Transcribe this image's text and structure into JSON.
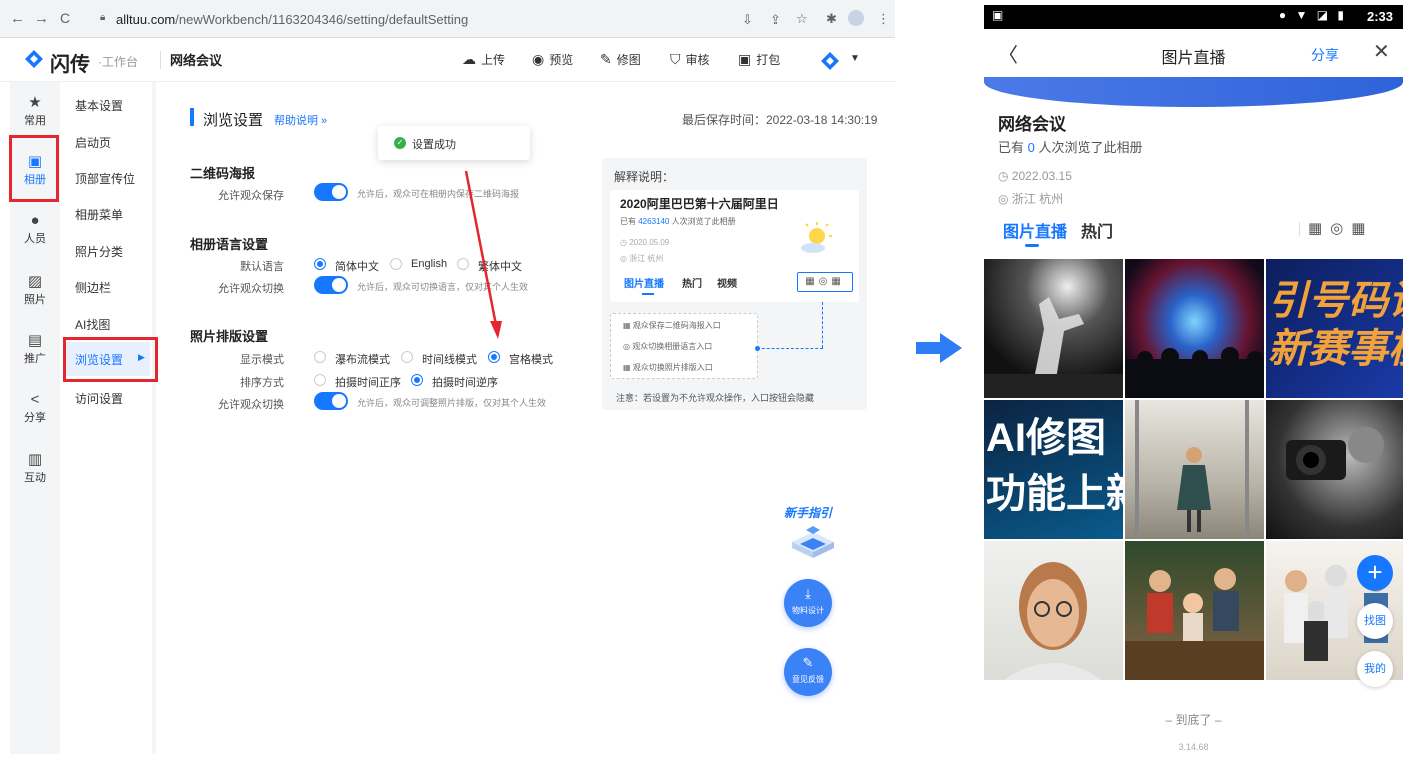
{
  "browser": {
    "url_host": "alltuu.com",
    "url_path": "/newWorkbench/1163204346/setting/defaultSetting",
    "back_icon": "←",
    "forward_icon": "→",
    "reload_icon": "C"
  },
  "header": {
    "brand": "闪传",
    "brand_sub": "·工作台",
    "project": "网络会议",
    "tools": [
      {
        "label": "上传",
        "icon": "cloud-upload-icon"
      },
      {
        "label": "预览",
        "icon": "eye-icon"
      },
      {
        "label": "修图",
        "icon": "brush-icon"
      },
      {
        "label": "审核",
        "icon": "shield-icon"
      },
      {
        "label": "打包",
        "icon": "package-icon"
      }
    ]
  },
  "leftbar": {
    "items": [
      {
        "label": "常用",
        "icon": "★"
      },
      {
        "label": "相册",
        "icon": "▣"
      },
      {
        "label": "人员",
        "icon": "●"
      },
      {
        "label": "照片",
        "icon": "▨"
      },
      {
        "label": "推广",
        "icon": "▤"
      },
      {
        "label": "分享",
        "icon": "<"
      },
      {
        "label": "互动",
        "icon": "▥"
      }
    ]
  },
  "subnav": {
    "items": [
      "基本设置",
      "启动页",
      "顶部宣传位",
      "相册菜单",
      "照片分类",
      "侧边栏",
      "AI找图",
      "浏览设置",
      "访问设置"
    ],
    "active_arrow": "▶"
  },
  "main": {
    "title": "浏览设置",
    "help": "帮助说明 »",
    "savetime": "最后保存时间：2022-03-18 14:30:19",
    "toast": "设置成功",
    "sections": {
      "qr": {
        "title": "二维码海报",
        "label": "允许观众保存",
        "hint": "允许后，观众可在相册内保存二维码海报"
      },
      "lang": {
        "title": "相册语言设置",
        "default_label": "默认语言",
        "options": [
          "简体中文",
          "English",
          "繁体中文"
        ],
        "switch_label": "允许观众切换",
        "hint": "允许后，观众可切换语言，仅对其个人生效"
      },
      "layout": {
        "title": "照片排版设置",
        "mode_label": "显示模式",
        "modes": [
          "瀑布流模式",
          "时间线模式",
          "宫格模式"
        ],
        "sort_label": "排序方式",
        "sorts": [
          "拍摄时间正序",
          "拍摄时间逆序"
        ],
        "switch_label": "允许观众切换",
        "hint": "允许后，观众可调整照片排版，仅对其个人生效"
      }
    }
  },
  "explain": {
    "title": "解释说明：",
    "album": "2020阿里巴巴第十六届阿里日",
    "views_prefix": "已有 ",
    "views_count": "4263140",
    "views_suffix": " 人次浏览了此相册",
    "date": "◷ 2020.05.09",
    "location": "◎ 浙江 杭州",
    "tabs": [
      "图片直播",
      "热门",
      "视频"
    ],
    "icons": "▦◎▦",
    "list": [
      "▦  观众保存二维码海报入口",
      "◎  观众切换相册语言入口",
      "▦  观众切换照片排版入口"
    ],
    "note": "注意：若设置为不允许观众操作，入口按钮会隐藏"
  },
  "floating": {
    "guide": "新手指引",
    "material_icon": "⤓",
    "material": "物料设计",
    "feedback_icon": "✎",
    "feedback": "意见反馈"
  },
  "phone": {
    "time": "2:33",
    "status_icons": "● ▼ ◪ ▮",
    "status_img_icon": "▣",
    "back": "〈",
    "title": "图片直播",
    "share": "分享",
    "close": "✕",
    "album": "网络会议",
    "views_prefix": "已有 ",
    "views_count": "0",
    "views_suffix": " 人次浏览了此相册",
    "date": "◷  2022.03.15",
    "location": "◎  浙江 杭州",
    "tabs": [
      "图片直播",
      "热门"
    ],
    "tool_icons": "▦◎▦",
    "end": "–    到底了    –",
    "version": "3.14.68",
    "plus": "+",
    "find": "找图",
    "mine": "我的",
    "photo_texts": {
      "c3": "引号码识\n新赛事模",
      "c4": "AI修图\n功能上新"
    }
  }
}
